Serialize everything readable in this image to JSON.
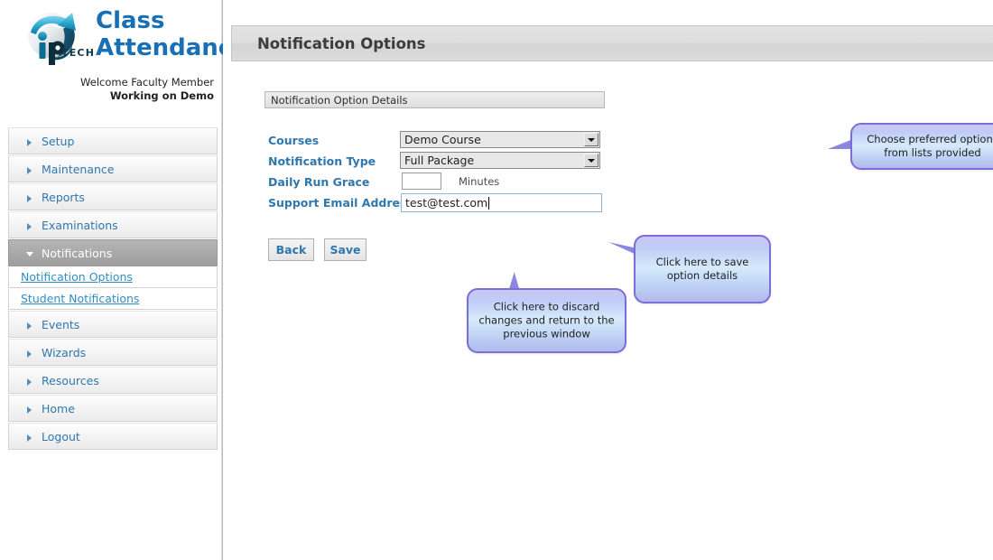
{
  "brand": {
    "logo_icon": "iptech-globe-arrow-logo",
    "logo_text_primary": "ip",
    "logo_text_secondary": "TECH",
    "title_line1": "Class",
    "title_line2": "Attendance",
    "welcome_line1": "Welcome Faculty Member",
    "welcome_line2": "Working on Demo",
    "accent_color": "#1770b5"
  },
  "sidebar": {
    "items": [
      {
        "label": "Setup",
        "state": "collapsed",
        "icon": "chevron-right-icon"
      },
      {
        "label": "Maintenance",
        "state": "collapsed",
        "icon": "chevron-right-icon"
      },
      {
        "label": "Reports",
        "state": "collapsed",
        "icon": "chevron-right-icon"
      },
      {
        "label": "Examinations",
        "state": "collapsed",
        "icon": "chevron-right-icon"
      },
      {
        "label": "Notifications",
        "state": "expanded",
        "icon": "chevron-down-icon"
      },
      {
        "label": "Events",
        "state": "collapsed",
        "icon": "chevron-right-icon"
      },
      {
        "label": "Wizards",
        "state": "collapsed",
        "icon": "chevron-right-icon"
      },
      {
        "label": "Resources",
        "state": "collapsed",
        "icon": "chevron-right-icon"
      },
      {
        "label": "Home",
        "state": "collapsed",
        "icon": "chevron-right-icon"
      },
      {
        "label": "Logout",
        "state": "collapsed",
        "icon": "chevron-right-icon"
      }
    ],
    "sub_items": [
      {
        "label": "Notification Options"
      },
      {
        "label": "Student Notifications"
      }
    ],
    "link_color": "#2f8fc4"
  },
  "header": {
    "page_title": "Notification Options"
  },
  "form": {
    "section_title": "Notification Option Details",
    "fields": {
      "courses": {
        "label": "Courses",
        "value": "Demo Course",
        "control": "dropdown"
      },
      "notification_type": {
        "label": "Notification Type",
        "value": "Full Package",
        "control": "dropdown"
      },
      "daily_run_grace": {
        "label": "Daily Run Grace",
        "value": "",
        "unit": "Minutes",
        "control": "textbox"
      },
      "support_email": {
        "label": "Support Email Addresses",
        "value": "test@test.com",
        "control": "textbox",
        "focused": true
      }
    }
  },
  "buttons": {
    "back_label": "Back",
    "save_label": "Save"
  },
  "callouts": [
    {
      "id": "choose",
      "line1": "Choose preferred options",
      "line2": "from lists provided",
      "points_to": "courses-dropdown"
    },
    {
      "id": "save",
      "line1": "Click here to save",
      "line2": "option details",
      "points_to": "save-button"
    },
    {
      "id": "back",
      "line1": "Click here to discard",
      "line2": "changes and return to the",
      "line3": "previous window",
      "points_to": "back-button"
    }
  ]
}
